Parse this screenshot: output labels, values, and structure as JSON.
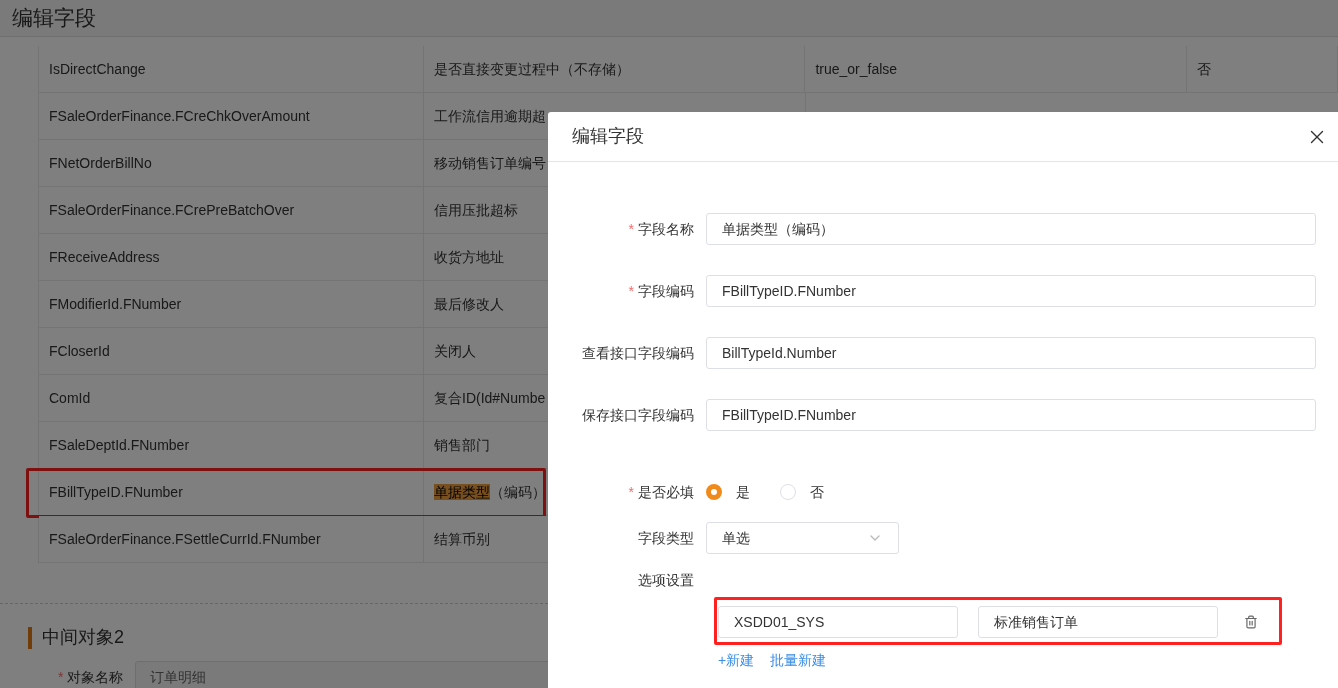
{
  "page": {
    "title": "编辑字段"
  },
  "table": {
    "rows": [
      {
        "cells": [
          "IsDirectChange",
          "是否直接变更过程中（不存储）",
          "true_or_false",
          "否"
        ],
        "highlighted": false
      },
      {
        "cells": [
          "FSaleOrderFinance.FCreChkOverAmount",
          "工作流信用逾期超"
        ],
        "highlighted": false
      },
      {
        "cells": [
          "FNetOrderBillNo",
          "移动销售订单编号"
        ],
        "highlighted": false
      },
      {
        "cells": [
          "FSaleOrderFinance.FCrePreBatchOver",
          "信用压批超标"
        ],
        "highlighted": false
      },
      {
        "cells": [
          "FReceiveAddress",
          "收货方地址"
        ],
        "highlighted": false
      },
      {
        "cells": [
          "FModifierId.FNumber",
          "最后修改人"
        ],
        "highlighted": false
      },
      {
        "cells": [
          "FCloserId",
          "关闭人"
        ],
        "highlighted": false
      },
      {
        "cells": [
          "ComId",
          "复合ID(Id#Numbe"
        ],
        "highlighted": false
      },
      {
        "cells": [
          "FSaleDeptId.FNumber",
          "销售部门"
        ],
        "highlighted": false
      },
      {
        "cells": [
          "FBillTypeID.FNumber",
          {
            "parts": [
              {
                "text": "单据类型",
                "highlighted": true
              },
              {
                "text": "（编码）",
                "highlighted": false
              }
            ]
          }
        ],
        "highlighted": true
      },
      {
        "cells": [
          "FSaleOrderFinance.FSettleCurrId.FNumber",
          "结算币别"
        ],
        "highlighted": false
      }
    ]
  },
  "section": {
    "title": "中间对象2",
    "field": {
      "label": "对象名称",
      "required_mark": "*",
      "value": "订单明细"
    }
  },
  "dialog": {
    "title": "编辑字段",
    "fields": [
      {
        "kind": "input",
        "label": "字段名称",
        "required_mark": "*",
        "value": "单据类型（编码）"
      },
      {
        "kind": "input",
        "label": "字段编码",
        "required_mark": "*",
        "value": "FBillTypeID.FNumber"
      },
      {
        "kind": "input",
        "label": "查看接口字段编码",
        "value": "BillTypeId.Number"
      },
      {
        "kind": "input",
        "label": "保存接口字段编码",
        "value": "FBillTypeID.FNumber"
      },
      {
        "kind": "radio",
        "label": "是否必填",
        "required_mark": "*",
        "options": [
          {
            "label": "是",
            "selected": true
          },
          {
            "label": "否",
            "selected": false
          }
        ]
      },
      {
        "kind": "select",
        "label": "字段类型",
        "value": "单选"
      }
    ],
    "options": {
      "label": "选项设置",
      "rows": [
        {
          "code": "XSDD01_SYS",
          "name": "标准销售订单",
          "highlighted": true
        }
      ],
      "links": [
        "+新建",
        "批量新建"
      ]
    }
  }
}
